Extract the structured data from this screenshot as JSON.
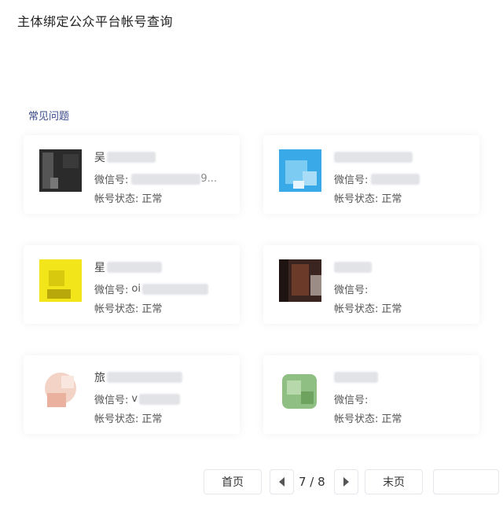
{
  "header": {
    "title": "主体绑定公众平台帐号查询"
  },
  "faq": {
    "label": "常见问题"
  },
  "colors": {
    "accent": "#3a4a8a",
    "border": "#e4e6ec"
  },
  "accounts": [
    {
      "name_prefix": "吴",
      "wechat_label": "微信号:",
      "wechat_value": "9...",
      "status_label": "帐号状态:",
      "status_value": "正常",
      "avatar_color": "#2b2b2b"
    },
    {
      "name_prefix": "",
      "wechat_label": "微信号:",
      "wechat_value": "",
      "status_label": "帐号状态:",
      "status_value": "正常",
      "avatar_color": "#39a9e8"
    },
    {
      "name_prefix": "星",
      "wechat_label": "微信号:",
      "wechat_value": "oi",
      "status_label": "帐号状态:",
      "status_value": "正常",
      "avatar_color": "#f2e51a"
    },
    {
      "name_prefix": "",
      "wechat_label": "微信号:",
      "wechat_value": "",
      "status_label": "帐号状态:",
      "status_value": "正常",
      "avatar_color": "#3a2520"
    },
    {
      "name_prefix": "旅",
      "wechat_label": "微信号:",
      "wechat_value": "v",
      "status_label": "帐号状态:",
      "status_value": "正常",
      "avatar_color": "#f3d3c6"
    },
    {
      "name_prefix": "",
      "wechat_label": "微信号:",
      "wechat_value": "",
      "status_label": "帐号状态:",
      "status_value": "正常",
      "avatar_color": "#8fbf82"
    }
  ],
  "pagination": {
    "first_label": "首页",
    "last_label": "末页",
    "current": 7,
    "total": 8,
    "indicator": "7 / 8"
  }
}
